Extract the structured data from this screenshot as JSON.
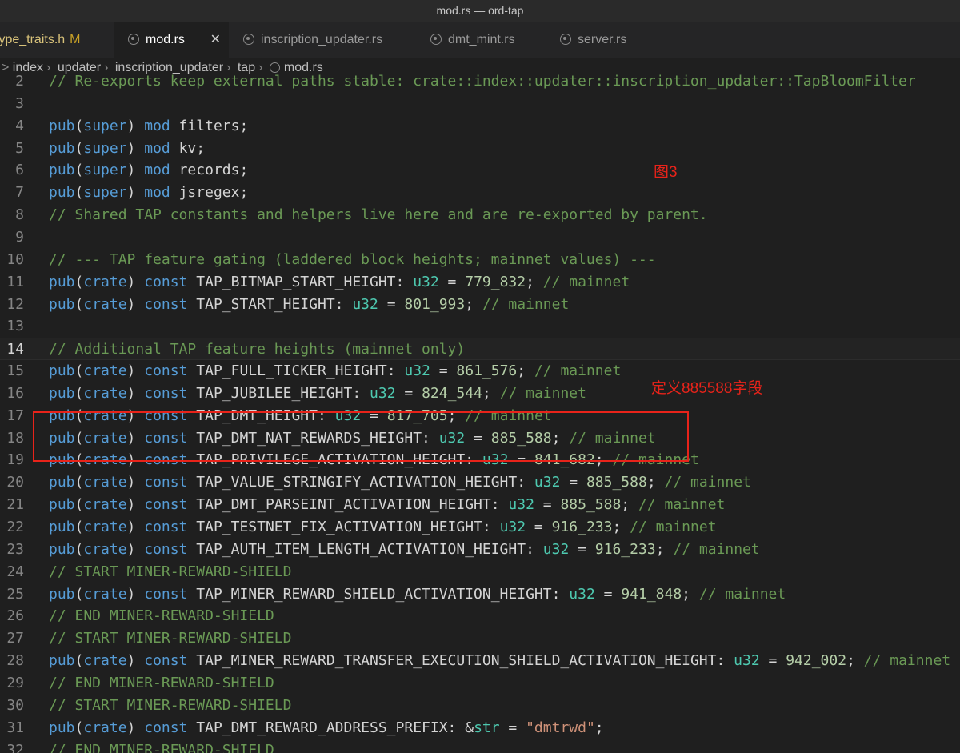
{
  "window": {
    "title": "mod.rs — ord-tap"
  },
  "tabs": [
    {
      "label": "type_traits.h",
      "flag": "M"
    },
    {
      "label": "mod.rs",
      "close": "✕"
    },
    {
      "label": "inscription_updater.rs"
    },
    {
      "label": "dmt_mint.rs"
    },
    {
      "label": "server.rs"
    }
  ],
  "breadcrumb": [
    ">",
    "index",
    "updater",
    "inscription_updater",
    "tap",
    "mod.rs"
  ],
  "editor": {
    "lines": [
      {
        "n": "2",
        "t": "// Re-exports keep external paths stable: crate::index::updater::inscription_updater::TapBloomFilter"
      },
      {
        "n": "3",
        "t": ""
      },
      {
        "n": "4",
        "t": "pub(super) mod filters;"
      },
      {
        "n": "5",
        "t": "pub(super) mod kv;"
      },
      {
        "n": "6",
        "t": "pub(super) mod records;"
      },
      {
        "n": "7",
        "t": "pub(super) mod jsregex;"
      },
      {
        "n": "8",
        "t": "// Shared TAP constants and helpers live here and are re-exported by parent."
      },
      {
        "n": "9",
        "t": ""
      },
      {
        "n": "10",
        "t": "// --- TAP feature gating (laddered block heights; mainnet values) ---"
      },
      {
        "n": "11",
        "t": "pub(crate) const TAP_BITMAP_START_HEIGHT: u32 = 779_832; // mainnet"
      },
      {
        "n": "12",
        "t": "pub(crate) const TAP_START_HEIGHT: u32 = 801_993; // mainnet"
      },
      {
        "n": "13",
        "t": ""
      },
      {
        "n": "14",
        "t": "// Additional TAP feature heights (mainnet only)"
      },
      {
        "n": "15",
        "t": "pub(crate) const TAP_FULL_TICKER_HEIGHT: u32 = 861_576; // mainnet"
      },
      {
        "n": "16",
        "t": "pub(crate) const TAP_JUBILEE_HEIGHT: u32 = 824_544; // mainnet"
      },
      {
        "n": "17",
        "t": "pub(crate) const TAP_DMT_HEIGHT: u32 = 817_705; // mainnet"
      },
      {
        "n": "18",
        "t": "pub(crate) const TAP_DMT_NAT_REWARDS_HEIGHT: u32 = 885_588; // mainnet"
      },
      {
        "n": "19",
        "t": "pub(crate) const TAP_PRIVILEGE_ACTIVATION_HEIGHT: u32 = 841_682; // mainnet"
      },
      {
        "n": "20",
        "t": "pub(crate) const TAP_VALUE_STRINGIFY_ACTIVATION_HEIGHT: u32 = 885_588; // mainnet"
      },
      {
        "n": "21",
        "t": "pub(crate) const TAP_DMT_PARSEINT_ACTIVATION_HEIGHT: u32 = 885_588; // mainnet"
      },
      {
        "n": "22",
        "t": "pub(crate) const TAP_TESTNET_FIX_ACTIVATION_HEIGHT: u32 = 916_233; // mainnet"
      },
      {
        "n": "23",
        "t": "pub(crate) const TAP_AUTH_ITEM_LENGTH_ACTIVATION_HEIGHT: u32 = 916_233; // mainnet"
      },
      {
        "n": "24",
        "t": "// START MINER-REWARD-SHIELD"
      },
      {
        "n": "25",
        "t": "pub(crate) const TAP_MINER_REWARD_SHIELD_ACTIVATION_HEIGHT: u32 = 941_848; // mainnet"
      },
      {
        "n": "26",
        "t": "// END MINER-REWARD-SHIELD"
      },
      {
        "n": "27",
        "t": "// START MINER-REWARD-SHIELD"
      },
      {
        "n": "28",
        "t": "pub(crate) const TAP_MINER_REWARD_TRANSFER_EXECUTION_SHIELD_ACTIVATION_HEIGHT: u32 = 942_002; // mainnet"
      },
      {
        "n": "29",
        "t": "// END MINER-REWARD-SHIELD"
      },
      {
        "n": "30",
        "t": "// START MINER-REWARD-SHIELD"
      },
      {
        "n": "31",
        "t": "pub(crate) const TAP_DMT_REWARD_ADDRESS_PREFIX: &str = \"dmtrwd\";"
      },
      {
        "n": "32",
        "t": "// END MINER-REWARD-SHIELD"
      }
    ],
    "current_line": "14"
  },
  "annotations": {
    "figure_label": "图3",
    "field_note": "定义885588字段",
    "color": "#e8231a"
  },
  "colors": {
    "background": "#1f1f1f",
    "keyword": "#569cd6",
    "comment": "#6a9955",
    "type": "#4ec9b0",
    "number": "#b5cea8",
    "string": "#ce9178"
  }
}
